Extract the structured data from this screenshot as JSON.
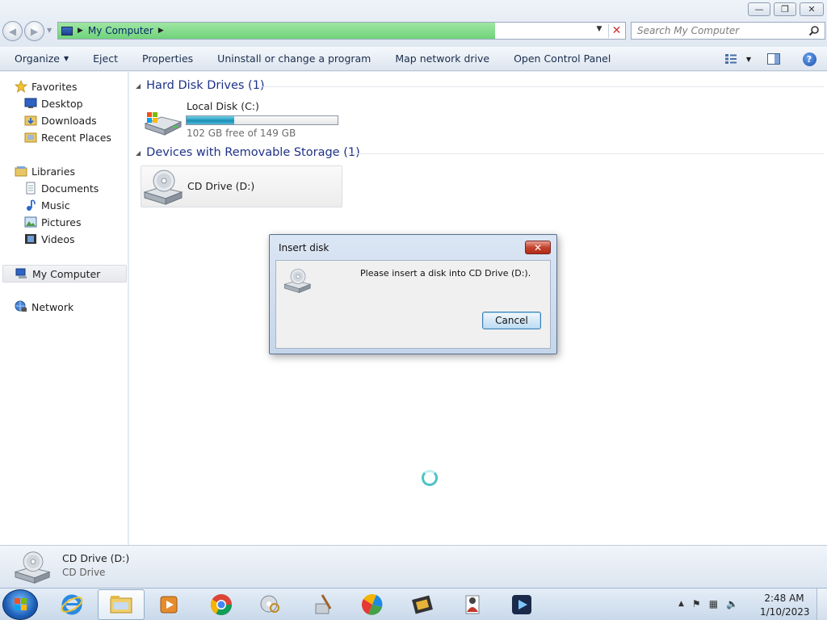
{
  "window": {
    "minimize_glyph": "—",
    "maximize_glyph": "❐",
    "close_glyph": "✕"
  },
  "address": {
    "location": "My Computer",
    "load_progress": 0.77
  },
  "search": {
    "placeholder": "Search My Computer"
  },
  "toolbar": {
    "organize": "Organize",
    "eject": "Eject",
    "properties": "Properties",
    "uninstall": "Uninstall or change a program",
    "map_drive": "Map network drive",
    "control_panel": "Open Control Panel",
    "help_glyph": "?"
  },
  "nav": {
    "favorites": "Favorites",
    "desktop": "Desktop",
    "downloads": "Downloads",
    "recent_places": "Recent Places",
    "libraries": "Libraries",
    "documents": "Documents",
    "music": "Music",
    "pictures": "Pictures",
    "videos": "Videos",
    "my_computer": "My Computer",
    "network": "Network"
  },
  "content": {
    "hdd_group": "Hard Disk Drives (1)",
    "removable_group": "Devices with Removable Storage (1)",
    "drive_c": {
      "label": "Local Disk (C:)",
      "free_text": "102 GB free of 149 GB",
      "used_fraction": 0.315
    },
    "drive_d": {
      "label": "CD Drive (D:)"
    }
  },
  "dialog": {
    "title": "Insert disk",
    "message": "Please insert a disk into CD Drive (D:).",
    "cancel": "Cancel",
    "close_glyph": "✕"
  },
  "details": {
    "name": "CD Drive (D:)",
    "type": "CD Drive"
  },
  "taskbar": {
    "time": "2:48 AM",
    "date": "1/10/2023"
  }
}
